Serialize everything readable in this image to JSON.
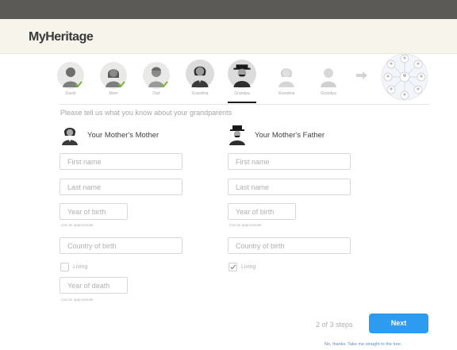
{
  "app": {
    "logo_text": "MyHeritage"
  },
  "steps": [
    {
      "label": "David",
      "state": "done"
    },
    {
      "label": "Mom",
      "state": "done"
    },
    {
      "label": "Dad",
      "state": "done"
    },
    {
      "label": "Grandma",
      "state": "current"
    },
    {
      "label": "Grandpa",
      "state": "current"
    },
    {
      "label": "Grandma",
      "state": "future"
    },
    {
      "label": "Grandpa",
      "state": "future"
    }
  ],
  "intro_text": "Please tell us what you know about your grandparents",
  "left_column": {
    "title": "Your Mother's Mother",
    "first_name_placeholder": "First name",
    "last_name_placeholder": "Last name",
    "year_of_birth_placeholder": "Year of birth",
    "year_of_birth_hint": "Can be approximate",
    "country_of_birth_placeholder": "Country of birth",
    "living_label": "Living",
    "living_checked": false,
    "year_of_death_placeholder": "Year of death",
    "year_of_death_hint": "Can be approximate"
  },
  "right_column": {
    "title": "Your Mother's Father",
    "first_name_placeholder": "First name",
    "last_name_placeholder": "Last name",
    "year_of_birth_placeholder": "Year of birth",
    "year_of_birth_hint": "Can be approximate",
    "country_of_birth_placeholder": "Country of birth",
    "living_label": "Living",
    "living_checked": true
  },
  "footer": {
    "steps_count": "2 of 3 steps",
    "next_label": "Next",
    "skip_link": "No, thanks. Take me straight to the tree."
  },
  "colors": {
    "accent": "#2d9cf0",
    "done_check": "#7ab33a",
    "topbar": "#5b5a57",
    "header_bg": "#f7f4ec"
  }
}
